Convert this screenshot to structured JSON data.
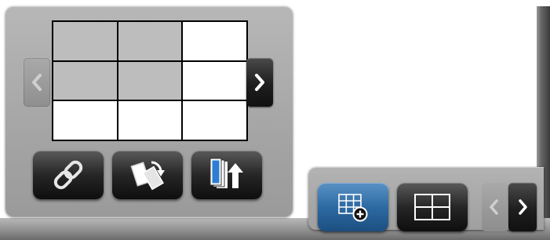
{
  "layout_grid": {
    "rows": 3,
    "cols": 3,
    "selected": [
      [
        true,
        true,
        false
      ],
      [
        true,
        true,
        false
      ],
      [
        false,
        false,
        false
      ]
    ]
  },
  "icons": {
    "prev": "chevron-left-icon",
    "next": "chevron-right-icon",
    "link": "chain-link-icon",
    "swap": "swap-rotate-icon",
    "stack_up": "stack-upload-icon",
    "grid_add": "grid-add-icon",
    "layout": "two-by-two-layout-icon"
  },
  "colors": {
    "panel": "#a5a5a5",
    "button_dark": "#1e1e1e",
    "button_active": "#2d6aa2",
    "accent_blue": "#2e7dd3",
    "cell_selected": "#bdbdbd",
    "cell_empty": "#ffffff"
  },
  "states": {
    "grid_prev_enabled": false,
    "grid_next_enabled": true,
    "mode_add_active": true,
    "mini_prev_enabled": false,
    "mini_next_enabled": true
  }
}
